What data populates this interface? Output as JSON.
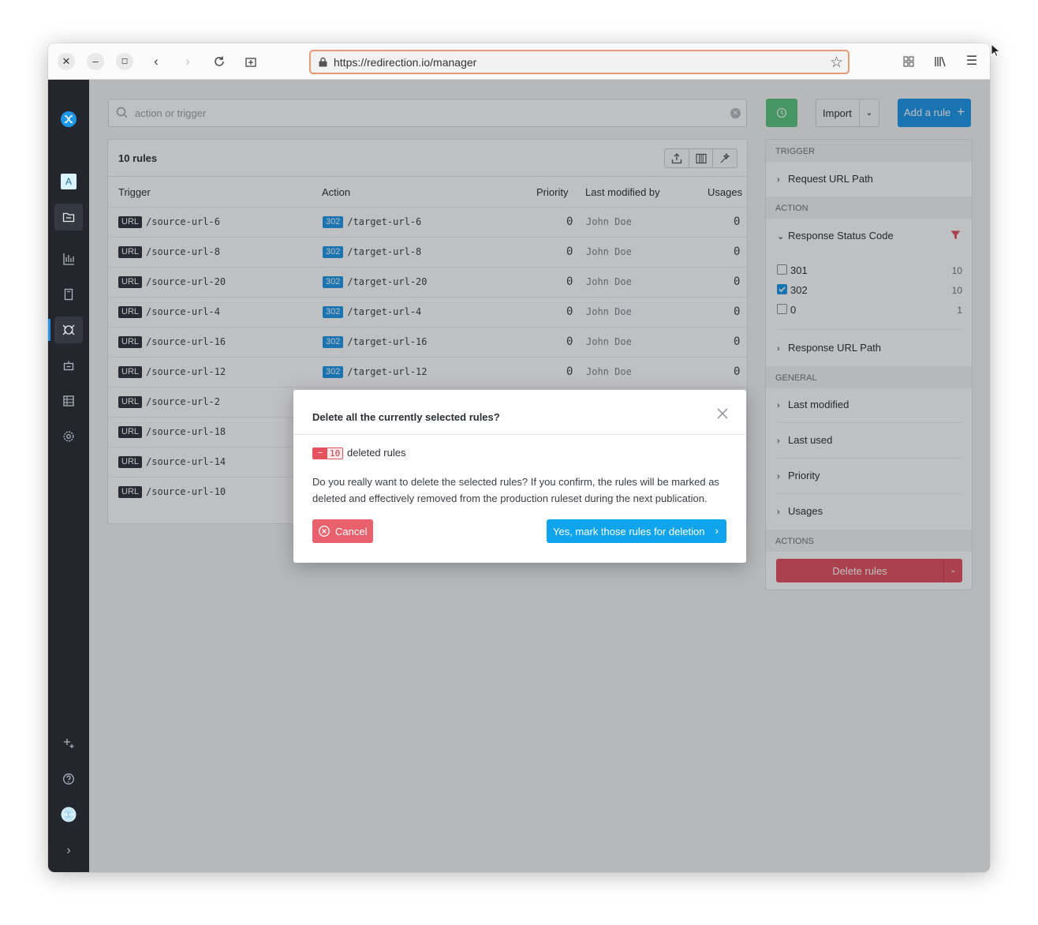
{
  "browser": {
    "url": "https://redirection.io/manager"
  },
  "sidebar": {
    "project_avatar": "A"
  },
  "toolbar": {
    "search_placeholder": "action or trigger",
    "import_label": "Import",
    "add_rule_label": "Add a rule"
  },
  "rules": {
    "count_label": "10 rules",
    "columns": {
      "trigger": "Trigger",
      "action": "Action",
      "priority": "Priority",
      "last_modified_by": "Last modified by",
      "usages": "Usages"
    },
    "trigger_tag": "URL",
    "rows": [
      {
        "trigger": "/source-url-6",
        "code": "302",
        "action": "/target-url-6",
        "priority": "0",
        "modified_by": "John Doe",
        "usages": "0"
      },
      {
        "trigger": "/source-url-8",
        "code": "302",
        "action": "/target-url-8",
        "priority": "0",
        "modified_by": "John Doe",
        "usages": "0"
      },
      {
        "trigger": "/source-url-20",
        "code": "302",
        "action": "/target-url-20",
        "priority": "0",
        "modified_by": "John Doe",
        "usages": "0"
      },
      {
        "trigger": "/source-url-4",
        "code": "302",
        "action": "/target-url-4",
        "priority": "0",
        "modified_by": "John Doe",
        "usages": "0"
      },
      {
        "trigger": "/source-url-16",
        "code": "302",
        "action": "/target-url-16",
        "priority": "0",
        "modified_by": "John Doe",
        "usages": "0"
      },
      {
        "trigger": "/source-url-12",
        "code": "302",
        "action": "/target-url-12",
        "priority": "0",
        "modified_by": "John Doe",
        "usages": "0"
      },
      {
        "trigger": "/source-url-2"
      },
      {
        "trigger": "/source-url-18"
      },
      {
        "trigger": "/source-url-14"
      },
      {
        "trigger": "/source-url-10"
      }
    ]
  },
  "filters": {
    "trigger_section": "TRIGGER",
    "request_url_path": "Request URL Path",
    "action_section": "ACTION",
    "response_status_code": "Response Status Code",
    "status_options": [
      {
        "label": "301",
        "count": "10",
        "checked": false
      },
      {
        "label": "302",
        "count": "10",
        "checked": true
      },
      {
        "label": "0",
        "count": "1",
        "checked": false
      }
    ],
    "response_url_path": "Response URL Path",
    "general_section": "GENERAL",
    "last_modified": "Last modified",
    "last_used": "Last used",
    "priority": "Priority",
    "usages": "Usages",
    "actions_section": "ACTIONS",
    "delete_rules": "Delete rules"
  },
  "modal": {
    "title": "Delete all the currently selected rules?",
    "badge_sign": "−",
    "badge_count": "10",
    "deleted_label": "deleted rules",
    "body": "Do you really want to delete the selected rules? If you confirm, the rules will be marked as deleted and effectively removed from the production ruleset during the next publication.",
    "cancel_label": "Cancel",
    "confirm_label": "Yes, mark those rules for deletion"
  },
  "colors": {
    "accent": "#1e97e8",
    "danger": "#e4525f",
    "success": "#5cc47e",
    "sidebar": "#23272d"
  }
}
